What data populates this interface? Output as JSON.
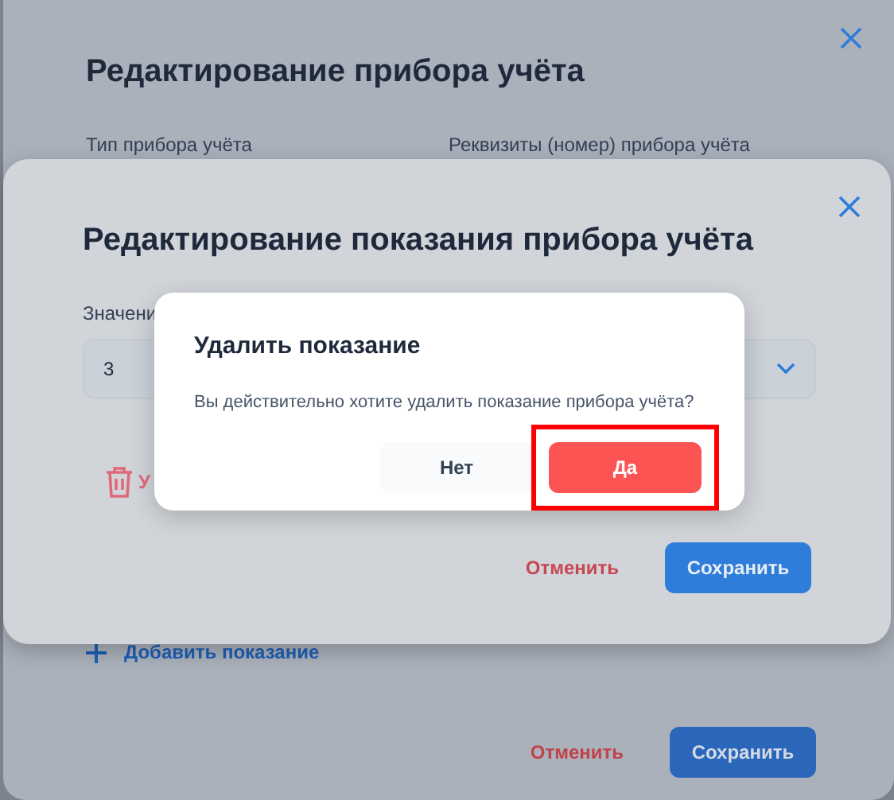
{
  "meter_modal": {
    "title": "Редактирование прибора учёта",
    "fields": [
      {
        "label": "Тип прибора учёта"
      },
      {
        "label": "Реквизиты (номер) прибора учёта"
      }
    ],
    "add_reading": "Добавить показание",
    "cancel": "Отменить",
    "save": "Сохранить"
  },
  "reading_modal": {
    "title": "Редактирование показания прибора учёта",
    "value_label": "Значени",
    "value": "3",
    "delete_label": "У",
    "cancel": "Отменить",
    "save": "Сохранить"
  },
  "confirm_dialog": {
    "title": "Удалить показание",
    "message": "Вы действительно хотите удалить показание прибора учёта?",
    "buttons": [
      {
        "label": "Нет",
        "kind": "secondary",
        "highlighted": false
      },
      {
        "label": "Да",
        "kind": "danger",
        "highlighted": true
      }
    ]
  }
}
